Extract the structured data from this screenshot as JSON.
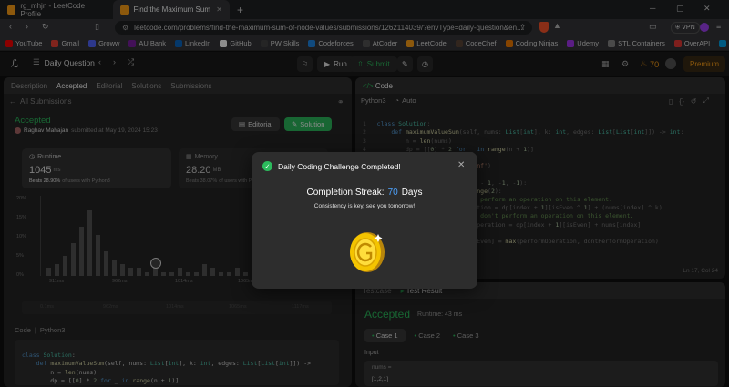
{
  "browser": {
    "tabs": [
      {
        "title": "rg_mhjn - LeetCode Profile"
      },
      {
        "title": "Find the Maximum Sum of Node"
      }
    ],
    "new_tab": "+",
    "url": "leetcode.com/problems/find-the-maximum-sum-of-node-values/submissions/1262114039/?envType=daily-question&en...",
    "vpn": "VPN"
  },
  "bookmarks": [
    {
      "label": "YouTube",
      "color": "#ff0000"
    },
    {
      "label": "Gmail",
      "color": "#ea4335"
    },
    {
      "label": "Groww",
      "color": "#5367ff"
    },
    {
      "label": "AU Bank",
      "color": "#7b1fa2"
    },
    {
      "label": "LinkedIn",
      "color": "#0a66c2"
    },
    {
      "label": "GitHub",
      "color": "#ffffff"
    },
    {
      "label": "PW Skills",
      "color": "#444444"
    },
    {
      "label": "Codeforces",
      "color": "#1e88e5"
    },
    {
      "label": "AtCoder",
      "color": "#555555"
    },
    {
      "label": "LeetCode",
      "color": "#ffa116"
    },
    {
      "label": "CodeChef",
      "color": "#5b4638"
    },
    {
      "label": "Coding Ninjas",
      "color": "#f57c00"
    },
    {
      "label": "Udemy",
      "color": "#a435f0"
    },
    {
      "label": "STL Containers",
      "color": "#888888"
    },
    {
      "label": "OverAPI",
      "color": "#e53935"
    },
    {
      "label": "Internshala",
      "color": "#00a5ec"
    }
  ],
  "lcnav": {
    "title": "Daily Question",
    "run": "Run",
    "submit": "Submit",
    "fire_count": "70",
    "premium": "Premium"
  },
  "left": {
    "tabs": {
      "description": "Description",
      "accepted": "Accepted",
      "editorial": "Editorial",
      "solutions": "Solutions",
      "submissions": "Submissions"
    },
    "all_submissions": "All Submissions",
    "status": "Accepted",
    "author": "Raghav Mahajan",
    "submitted_at": "submitted at May 19, 2024 15:23",
    "editorial_btn": "Editorial",
    "solution_btn": "Solution",
    "runtime": {
      "label": "Runtime",
      "value": "1045",
      "unit": "ms",
      "beats": "Beats 28.90%",
      "beats_suffix": "of users with Python3"
    },
    "memory": {
      "label": "Memory",
      "value": "28.20",
      "unit": "MB",
      "beats": "Beats 38.07%",
      "beats_suffix": "of users with Python3"
    },
    "yticks": [
      "20%",
      "15%",
      "10%",
      "5%",
      "0%"
    ],
    "xticks": [
      "911ms",
      "962ms",
      "1014ms",
      "1065ms",
      "1117ms"
    ],
    "x2ticks": [
      "0.1ms",
      "962ms",
      "1014ms",
      "1065ms",
      "1117ms"
    ],
    "code_label": "Code",
    "code_lang": "Python3"
  },
  "editor": {
    "header": "Code",
    "lang": "Python3",
    "auto": "Auto",
    "status": "Ln 17, Col 24"
  },
  "result": {
    "tab_testcase": "Testcase",
    "tab_result": "Test Result",
    "status": "Accepted",
    "runtime": "Runtime: 43 ms",
    "cases": [
      "Case 1",
      "Case 2",
      "Case 3"
    ],
    "input_label": "Input",
    "var": "nums =",
    "value": "[1,2,1]"
  },
  "modal": {
    "title": "Daily Coding Challenge Completed!",
    "streak_label": "Completion Streak:",
    "streak_value": "70",
    "streak_unit": "Days",
    "message": "Consistency is key, see you tomorrow!"
  }
}
